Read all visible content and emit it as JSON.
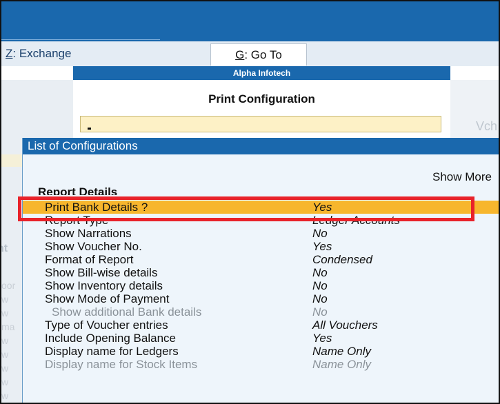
{
  "menubar": {
    "exchange": {
      "key": "Z",
      "label": ": Exchange"
    },
    "goto": {
      "key": "G",
      "label": ": Go To"
    }
  },
  "company": {
    "name": "Alpha Infotech"
  },
  "print_config": {
    "title": "Print Configuration",
    "input_value": ""
  },
  "background": {
    "vch_text": "Vch"
  },
  "list": {
    "title": "List of Configurations",
    "show_more": "Show More",
    "section": "Report Details",
    "rows": [
      {
        "label": "Print Bank Details ?",
        "value": "Yes"
      },
      {
        "label": "Report Type",
        "value": "Ledger Accounts"
      },
      {
        "label": "Show Narrations",
        "value": "No"
      },
      {
        "label": "Show Voucher No.",
        "value": "Yes"
      },
      {
        "label": "Format of Report",
        "value": "Condensed"
      },
      {
        "label": "Show Bill-wise details",
        "value": "No"
      },
      {
        "label": "Show Inventory details",
        "value": "No"
      },
      {
        "label": "Show Mode of Payment",
        "value": "No"
      },
      {
        "label": "Show additional Bank details",
        "value": "No"
      },
      {
        "label": "Type of Voucher entries",
        "value": "All Vouchers"
      },
      {
        "label": "Include Opening Balance",
        "value": "Yes"
      },
      {
        "label": "Display name for Ledgers",
        "value": "Name Only"
      },
      {
        "label": "Display name for Stock Items",
        "value": "Name Only"
      }
    ],
    "selected_index": 0
  },
  "colors": {
    "title_bar": "#1a68ad",
    "selection": "#f7b62d",
    "highlight_border": "#e8222a",
    "input_bg": "#fdf1c6"
  }
}
